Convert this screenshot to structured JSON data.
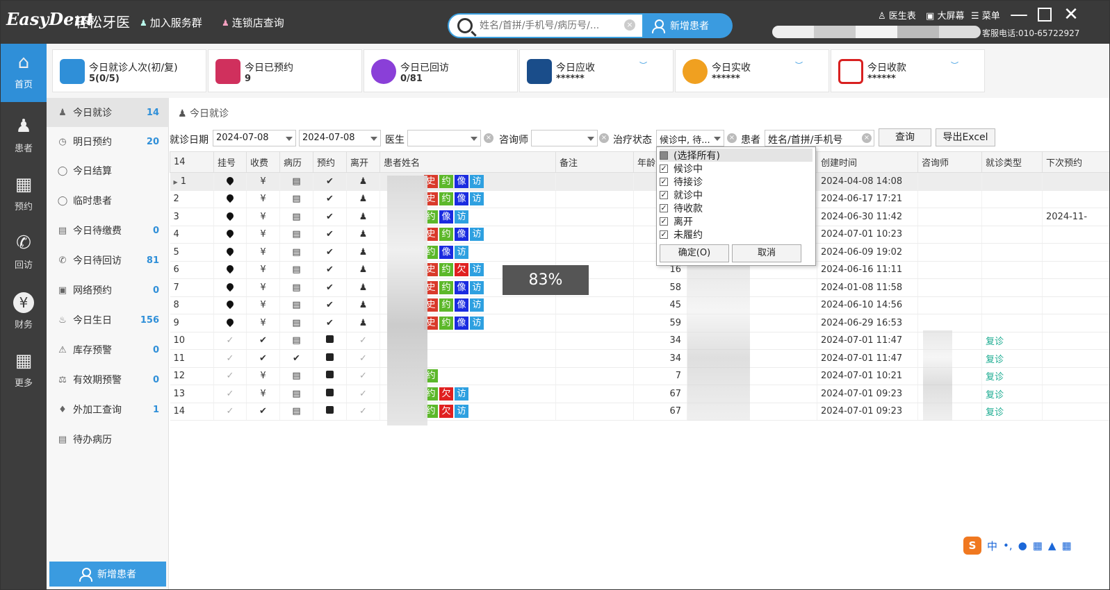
{
  "titlebar": {
    "logo": "EasyDent",
    "logo_cn": "轻松牙医",
    "join_group": "加入服务群",
    "chain_query": "连锁店查询",
    "search_placeholder": "姓名/首拼/手机号/病历号/...",
    "new_patient": "新增患者",
    "doctor_table": "医生表",
    "big_screen": "大屏幕",
    "menu": "菜单",
    "hotline": "客服电话:010-65722927"
  },
  "nav": [
    {
      "label": "首页",
      "icon": "home-icon"
    },
    {
      "label": "患者",
      "icon": "patients-icon"
    },
    {
      "label": "预约",
      "icon": "calendar-icon"
    },
    {
      "label": "回访",
      "icon": "phone-icon"
    },
    {
      "label": "财务",
      "icon": "yuan-icon"
    },
    {
      "label": "更多",
      "icon": "grid-icon"
    }
  ],
  "stats": [
    {
      "label": "今日就诊人次(初/复)",
      "value": "5(0/5)",
      "icon": "people-icon",
      "color": "#2f8fd8"
    },
    {
      "label": "今日已预约",
      "value": "9",
      "icon": "calendar-icon",
      "color": "#d0305d"
    },
    {
      "label": "今日已回访",
      "value": "0/81",
      "icon": "chat-icon",
      "color": "#8a3fd8"
    },
    {
      "label": "今日应收",
      "value": "******",
      "icon": "transfer-icon",
      "color": "#1a4d8a"
    },
    {
      "label": "今日实收",
      "value": "******",
      "icon": "moneybag-icon",
      "color": "#f0a020"
    },
    {
      "label": "今日收款",
      "value": "******",
      "icon": "yuan-bracket-icon",
      "color": "#d82020"
    }
  ],
  "side_menu": [
    {
      "label": "今日就诊",
      "count": "14"
    },
    {
      "label": "明日预约",
      "count": "20"
    },
    {
      "label": "今日结算",
      "count": ""
    },
    {
      "label": "临时患者",
      "count": ""
    },
    {
      "label": "今日待缴费",
      "count": "0"
    },
    {
      "label": "今日待回访",
      "count": "81"
    },
    {
      "label": "网络预约",
      "count": "0"
    },
    {
      "label": "今日生日",
      "count": "156"
    },
    {
      "label": "库存预警",
      "count": "0"
    },
    {
      "label": "有效期预警",
      "count": "0"
    },
    {
      "label": "外加工查询",
      "count": "1"
    },
    {
      "label": "待办病历",
      "count": ""
    }
  ],
  "side_new_patient": "新增患者",
  "breadcrumb": "今日就诊",
  "filters": {
    "date_label": "就诊日期",
    "date_from": "2024-07-08",
    "date_to": "2024-07-08",
    "doctor_label": "医生",
    "consultant_label": "咨询师",
    "status_label": "治疗状态",
    "status_value": "候诊中, 待...",
    "patient_label": "患者",
    "patient_placeholder": "姓名/首拼/手机号",
    "query_btn": "查询",
    "export_btn": "导出Excel"
  },
  "table": {
    "count": "14",
    "headers": [
      "挂号",
      "收费",
      "病历",
      "预约",
      "离开",
      "患者姓名",
      "备注",
      "年龄",
      "",
      "创建时间",
      "咨询师",
      "就诊类型",
      "下次预约"
    ],
    "rows": [
      {
        "no": "1",
        "reg": "pin",
        "fee": "¥",
        "rec": "doc",
        "appt": "check",
        "tags": [
          "史",
          "约",
          "像",
          "访"
        ],
        "age": "",
        "created": "2024-04-08 14:08",
        "type": "",
        "next": ""
      },
      {
        "no": "2",
        "reg": "pin",
        "fee": "¥",
        "rec": "doc",
        "appt": "check",
        "tags": [
          "史",
          "约",
          "像",
          "访"
        ],
        "age": "",
        "created": "2024-06-17 17:21",
        "type": "",
        "next": ""
      },
      {
        "no": "3",
        "reg": "pin",
        "fee": "¥",
        "rec": "doc",
        "appt": "check",
        "tags": [
          "约",
          "像",
          "访"
        ],
        "age": "",
        "created": "2024-06-30 11:42",
        "type": "",
        "next": "2024-11-"
      },
      {
        "no": "4",
        "reg": "pin",
        "fee": "¥",
        "rec": "doc",
        "appt": "check",
        "tags": [
          "史",
          "约",
          "像",
          "访"
        ],
        "age": "",
        "created": "2024-07-01 10:23",
        "type": "",
        "next": ""
      },
      {
        "no": "5",
        "reg": "pin",
        "fee": "¥",
        "rec": "doc",
        "appt": "check",
        "tags": [
          "约",
          "像",
          "访"
        ],
        "age": "",
        "created": "2024-06-09 19:02",
        "type": "",
        "next": ""
      },
      {
        "no": "6",
        "reg": "pin",
        "fee": "¥",
        "rec": "doc",
        "appt": "check",
        "tags": [
          "史",
          "约",
          "欠",
          "访"
        ],
        "age": "16",
        "created": "2024-06-16 11:11",
        "type": "",
        "next": ""
      },
      {
        "no": "7",
        "reg": "pin",
        "fee": "¥",
        "rec": "doc",
        "appt": "check",
        "tags": [
          "史",
          "约",
          "像",
          "访"
        ],
        "age": "58",
        "created": "2024-01-08 11:58",
        "type": "",
        "next": ""
      },
      {
        "no": "8",
        "reg": "pin",
        "fee": "¥",
        "rec": "doc",
        "appt": "check",
        "tags": [
          "史",
          "约",
          "像",
          "访"
        ],
        "age": "45",
        "created": "2024-06-10 14:56",
        "type": "",
        "next": ""
      },
      {
        "no": "9",
        "reg": "pin",
        "fee": "¥",
        "rec": "doc",
        "appt": "check",
        "tags": [
          "史",
          "约",
          "像",
          "访"
        ],
        "age": "59",
        "created": "2024-06-29 16:53",
        "type": "",
        "next": ""
      },
      {
        "no": "10",
        "reg": "gray",
        "fee": "✔",
        "rec": "doc",
        "appt": "block",
        "tags": [],
        "age": "34",
        "created": "2024-07-01 11:47",
        "type": "复诊",
        "next": ""
      },
      {
        "no": "11",
        "reg": "gray",
        "fee": "✔",
        "rec": "check",
        "appt": "block",
        "tags": [],
        "age": "34",
        "created": "2024-07-01 11:47",
        "type": "复诊",
        "next": ""
      },
      {
        "no": "12",
        "reg": "gray",
        "fee": "¥",
        "rec": "doc",
        "appt": "block",
        "tags": [
          "约"
        ],
        "age": "7",
        "created": "2024-07-01 10:21",
        "type": "复诊",
        "next": ""
      },
      {
        "no": "13",
        "reg": "gray",
        "fee": "¥",
        "rec": "doc",
        "appt": "block",
        "tags": [
          "约",
          "欠",
          "访"
        ],
        "age": "67",
        "created": "2024-07-01 09:23",
        "type": "复诊",
        "next": ""
      },
      {
        "no": "14",
        "reg": "gray",
        "fee": "✔",
        "rec": "doc",
        "appt": "block",
        "tags": [
          "约",
          "欠",
          "访"
        ],
        "age": "67",
        "created": "2024-07-01 09:23",
        "type": "复诊",
        "next": ""
      }
    ]
  },
  "status_dropdown": {
    "select_all": "(选择所有)",
    "options": [
      "候诊中",
      "待接诊",
      "就诊中",
      "待收款",
      "离开",
      "未履约"
    ],
    "ok": "确定(O)",
    "cancel": "取消"
  },
  "overlay_percent": "83%",
  "ime": {
    "logo": "S",
    "mode": "中"
  }
}
